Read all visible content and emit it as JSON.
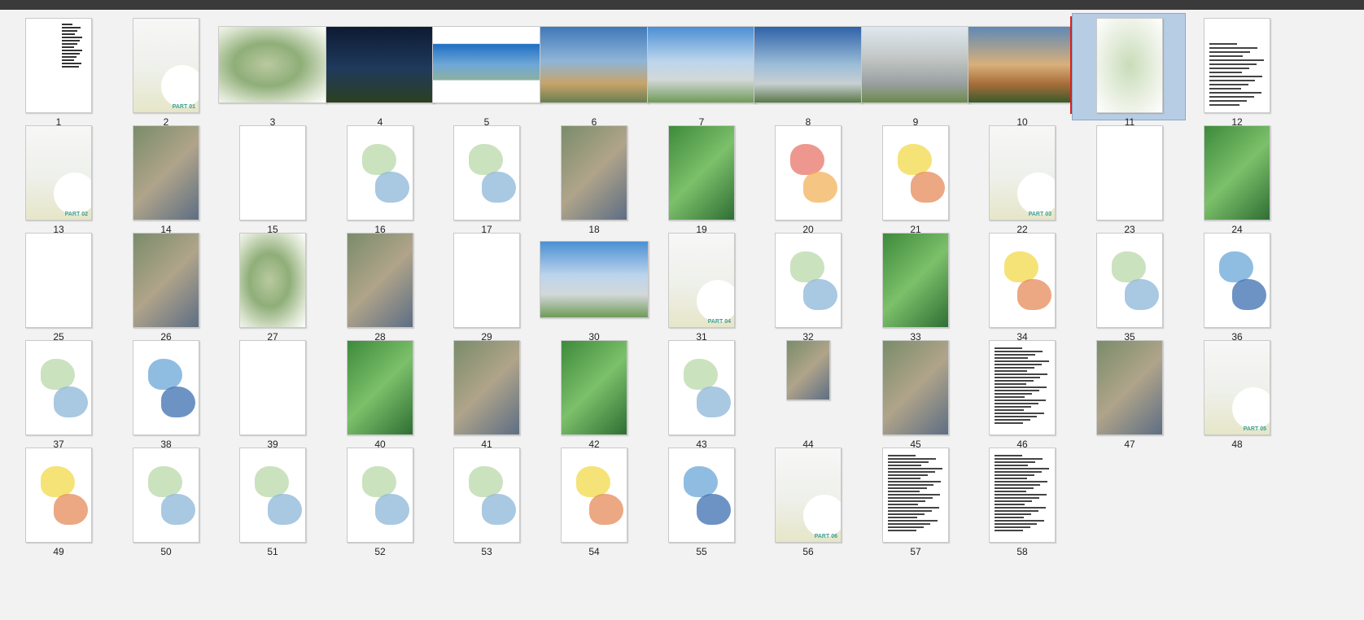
{
  "selected_page": "11",
  "pages": [
    {
      "label": "1",
      "kind": "text"
    },
    {
      "label": "2",
      "kind": "part",
      "part_tag": "PART 01"
    },
    {
      "label": "3",
      "kind": "aerial"
    },
    {
      "label": "4",
      "kind": "night"
    },
    {
      "label": "5",
      "kind": "panorama"
    },
    {
      "label": "6",
      "kind": "tower"
    },
    {
      "label": "7",
      "kind": "city"
    },
    {
      "label": "8",
      "kind": "cityb"
    },
    {
      "label": "9",
      "kind": "street"
    },
    {
      "label": "10",
      "kind": "sunset"
    },
    {
      "label": "11",
      "kind": "plan"
    },
    {
      "label": "12",
      "kind": "table"
    },
    {
      "label": "13",
      "kind": "part",
      "part_tag": "PART 02"
    },
    {
      "label": "14",
      "kind": "photo"
    },
    {
      "label": "15",
      "kind": "diagram"
    },
    {
      "label": "16",
      "kind": "map"
    },
    {
      "label": "17",
      "kind": "map"
    },
    {
      "label": "18",
      "kind": "photo"
    },
    {
      "label": "19",
      "kind": "green"
    },
    {
      "label": "20",
      "kind": "mapred"
    },
    {
      "label": "21",
      "kind": "mapyellow"
    },
    {
      "label": "22",
      "kind": "part",
      "part_tag": "PART 03"
    },
    {
      "label": "23",
      "kind": "diagram"
    },
    {
      "label": "24",
      "kind": "green"
    },
    {
      "label": "25",
      "kind": "diagram"
    },
    {
      "label": "26",
      "kind": "photo"
    },
    {
      "label": "27",
      "kind": "aerialp"
    },
    {
      "label": "28",
      "kind": "photo"
    },
    {
      "label": "29",
      "kind": "diagram"
    },
    {
      "label": "30",
      "kind": "city"
    },
    {
      "label": "31",
      "kind": "part",
      "part_tag": "PART 04"
    },
    {
      "label": "32",
      "kind": "map"
    },
    {
      "label": "33",
      "kind": "green"
    },
    {
      "label": "34",
      "kind": "mapyellow"
    },
    {
      "label": "35",
      "kind": "map"
    },
    {
      "label": "36",
      "kind": "mapblue"
    },
    {
      "label": "37",
      "kind": "map"
    },
    {
      "label": "38",
      "kind": "mapblue"
    },
    {
      "label": "39",
      "kind": "diagram"
    },
    {
      "label": "40",
      "kind": "green"
    },
    {
      "label": "41",
      "kind": "photo"
    },
    {
      "label": "42",
      "kind": "green"
    },
    {
      "label": "43",
      "kind": "map"
    },
    {
      "label": "44",
      "kind": "small"
    },
    {
      "label": "45",
      "kind": "photo"
    },
    {
      "label": "46",
      "kind": "doc"
    },
    {
      "label": "47",
      "kind": "photo"
    },
    {
      "label": "48",
      "kind": "part",
      "part_tag": "PART 05"
    },
    {
      "label": "49",
      "kind": "mapyellow"
    },
    {
      "label": "50",
      "kind": "map"
    },
    {
      "label": "51",
      "kind": "map"
    },
    {
      "label": "52",
      "kind": "map"
    },
    {
      "label": "53",
      "kind": "map"
    },
    {
      "label": "54",
      "kind": "mapyellow"
    },
    {
      "label": "55",
      "kind": "mapblue"
    },
    {
      "label": "56",
      "kind": "part",
      "part_tag": "PART 06"
    },
    {
      "label": "57",
      "kind": "doc"
    },
    {
      "label": "58",
      "kind": "doc"
    }
  ],
  "colors": {
    "selection_bg": "#b7cde4",
    "part_tag": "#3a9e8c",
    "insertion_mark": "#d62020",
    "top_bar": "#3a3a3a"
  }
}
